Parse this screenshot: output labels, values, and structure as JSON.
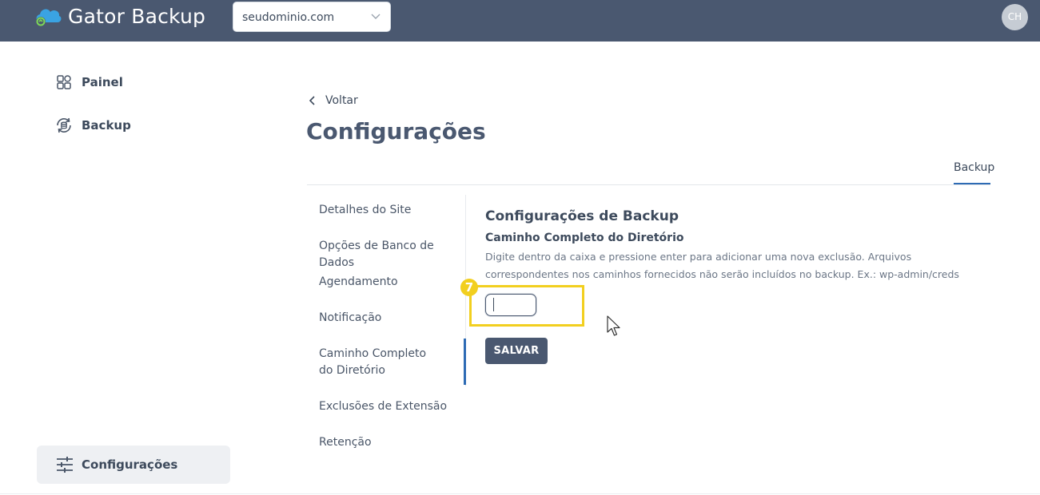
{
  "app": {
    "title": "Gator Backup"
  },
  "domain_selector": {
    "value": "seudominio.com"
  },
  "user": {
    "initials": "CH"
  },
  "sidebar": {
    "items": [
      {
        "label": "Painel",
        "icon": "dashboard-icon"
      },
      {
        "label": "Backup",
        "icon": "backup-icon"
      }
    ],
    "bottom_item": {
      "label": "Configurações",
      "icon": "sliders-icon"
    }
  },
  "main": {
    "back_label": "Voltar",
    "title": "Configurações",
    "tabs": [
      {
        "label": "Backup",
        "active": true
      }
    ],
    "settings_nav": [
      {
        "label": "Detalhes do Site"
      },
      {
        "label": "Opções de Banco de Dados"
      },
      {
        "label": "Agendamento"
      },
      {
        "label": "Notificação"
      },
      {
        "label": "Caminho Completo do Diretório",
        "active": true
      },
      {
        "label": "Exclusões de Extensão"
      },
      {
        "label": "Retenção"
      }
    ],
    "content": {
      "section_title": "Configurações de Backup",
      "field_label": "Caminho Completo do Diretório",
      "help_text": "Digite dentro da caixa e pressione enter para adicionar uma nova exclusão. Arquivos correspondentes nos caminhos fornecidos não serão incluídos no backup. Ex.: wp-admin/creds",
      "input_value": "",
      "save_label": "SALVAR",
      "step_number": "7"
    }
  },
  "colors": {
    "topbar": "#4a5870",
    "accent": "#2e6bb4",
    "highlight": "#f2cf1f"
  }
}
